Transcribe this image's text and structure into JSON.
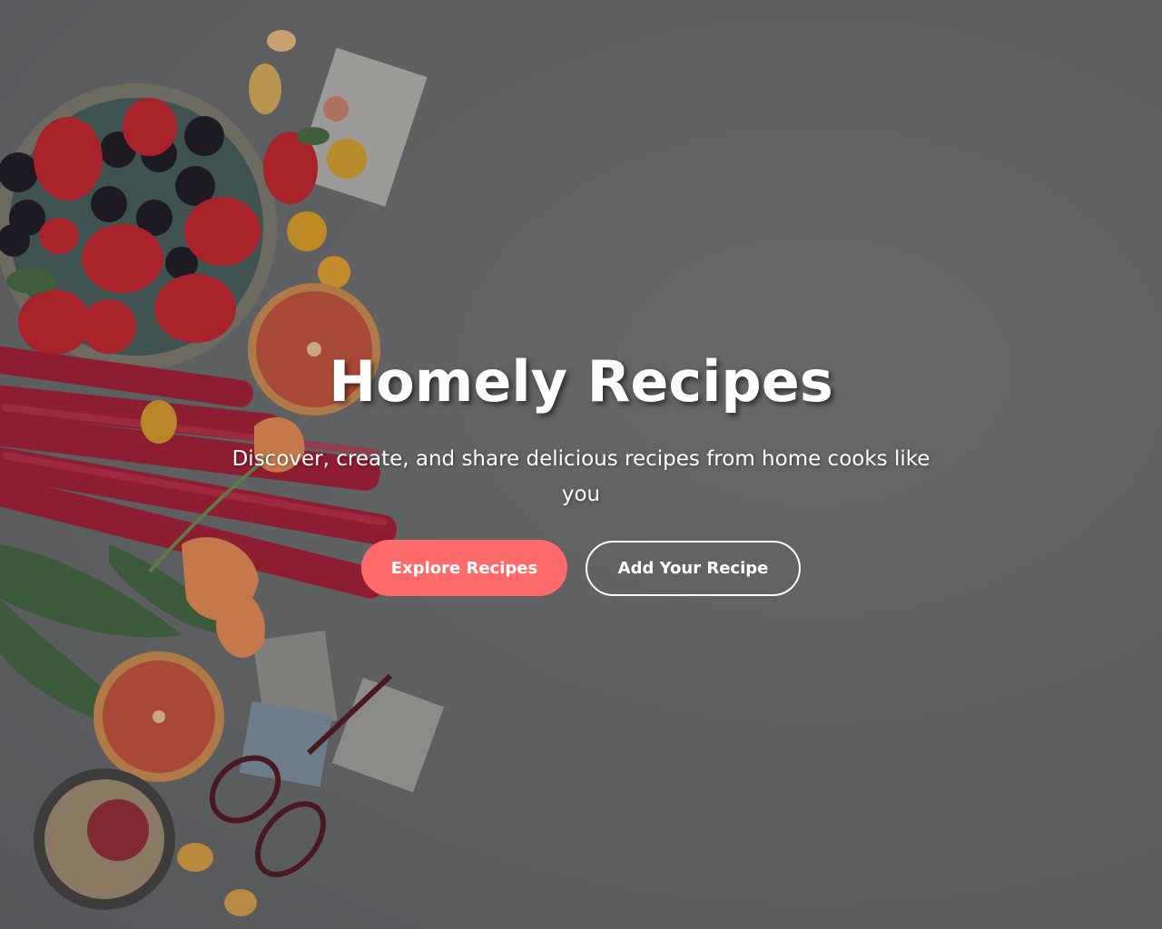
{
  "hero": {
    "title": "Homely Recipes",
    "subtitle": "Discover, create, and share delicious recipes from home cooks like you",
    "primary_button_label": "Explore Recipes",
    "secondary_button_label": "Add Your Recipe",
    "background_image": "food-flatlay-photo"
  },
  "colors": {
    "accent": "#ff6b6b",
    "overlay": "#5f6163",
    "text": "#ffffff"
  }
}
